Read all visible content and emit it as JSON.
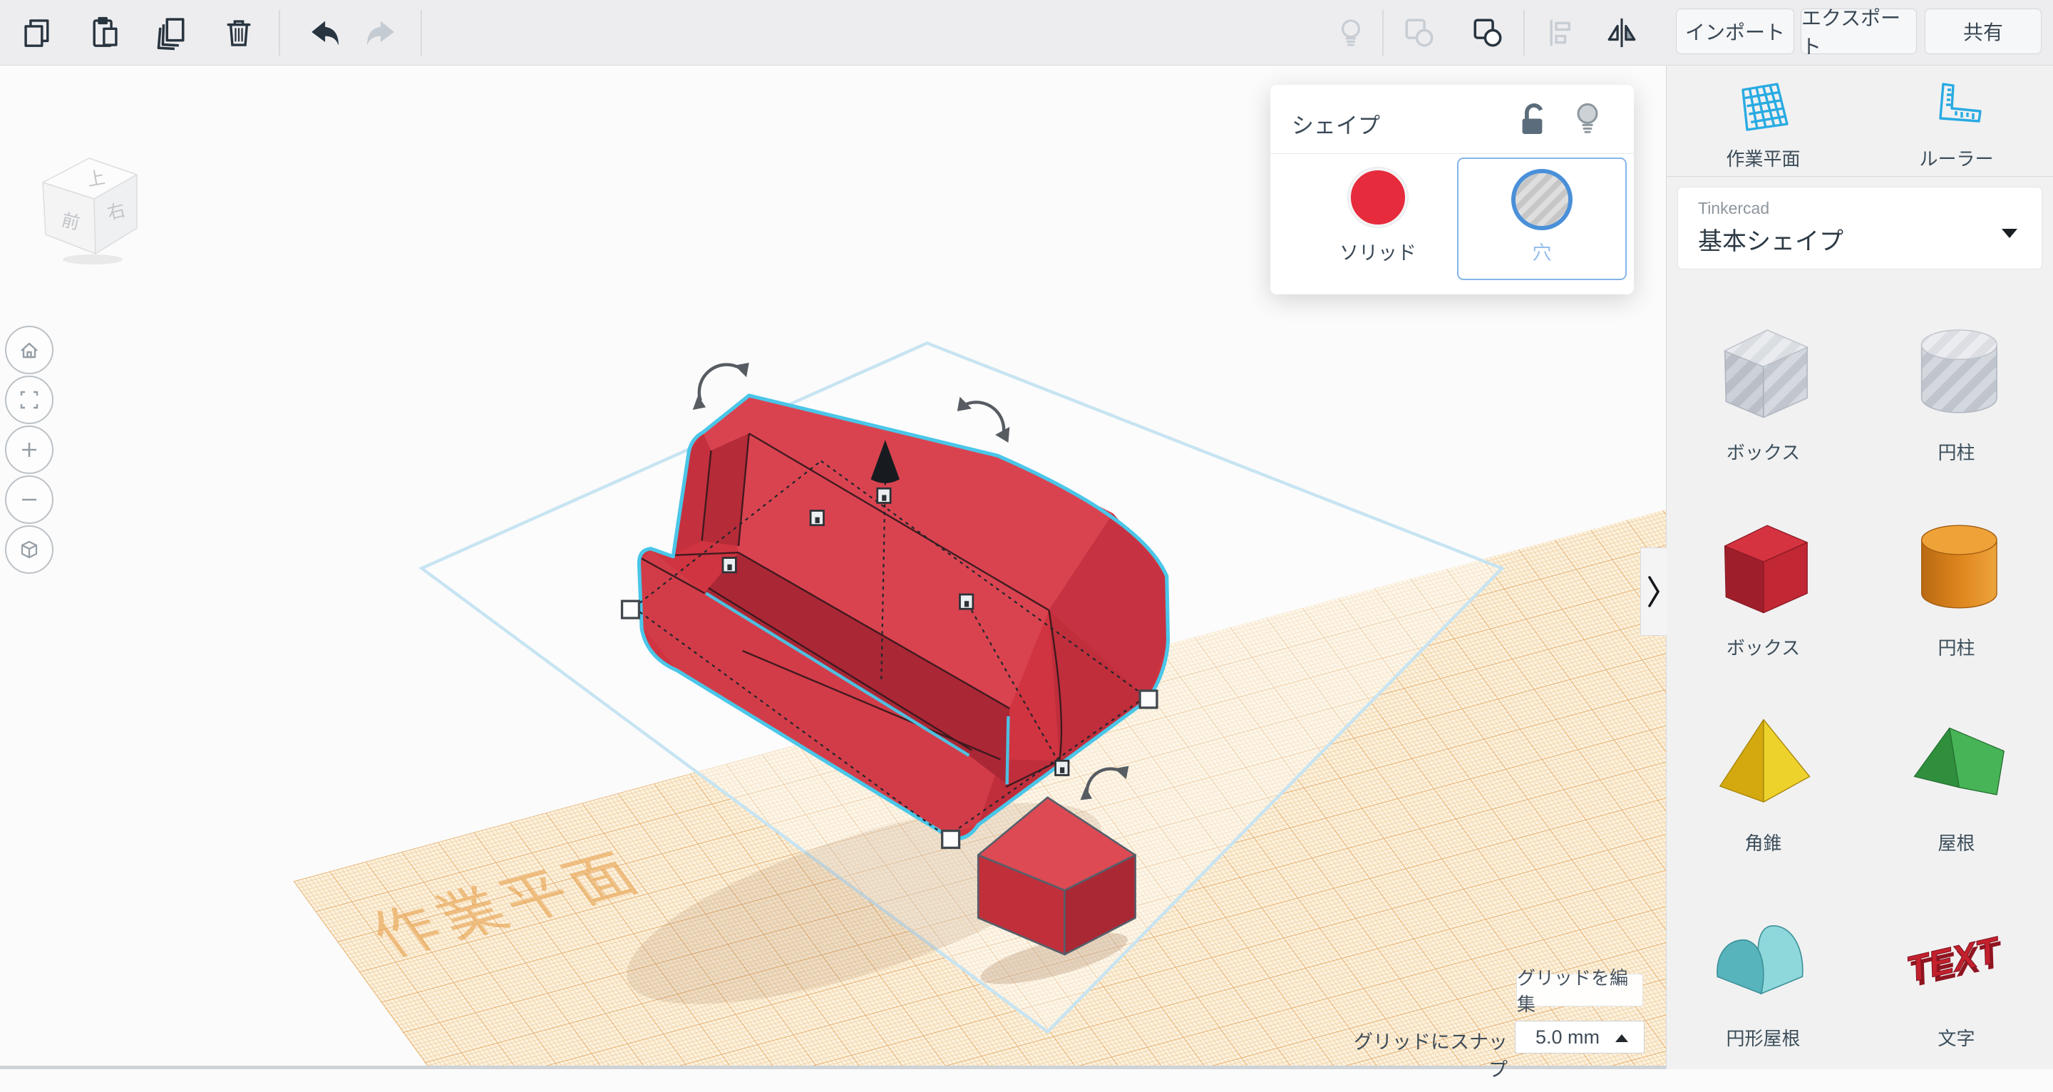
{
  "toolbar": {
    "import_label": "インポート",
    "export_label": "エクスポート",
    "share_label": "共有"
  },
  "shape_popup": {
    "title": "シェイプ",
    "solid_label": "ソリッド",
    "hole_label": "穴"
  },
  "right_panel": {
    "workplane_label": "作業平面",
    "ruler_label": "ルーラー",
    "collection_brand": "Tinkercad",
    "collection_name": "基本シェイプ",
    "shapes": [
      {
        "label": "ボックス"
      },
      {
        "label": "円柱"
      },
      {
        "label": "ボックス"
      },
      {
        "label": "円柱"
      },
      {
        "label": "角錐"
      },
      {
        "label": "屋根"
      },
      {
        "label": "円形屋根"
      },
      {
        "label": "文字",
        "thumb_text": "TEXT"
      }
    ]
  },
  "grid_controls": {
    "edit_label": "グリッドを編集",
    "snap_label": "グリッドにスナップ",
    "snap_value": "5.0 mm"
  },
  "view_cube": {
    "top": "上",
    "front": "前",
    "right": "右"
  },
  "viewport": {
    "watermark": "作業平面"
  },
  "colors": {
    "accent_blue": "#29abe2",
    "selection_cyan": "#4ac6e8",
    "solid_red": "#e62b3c",
    "hole_ring_blue": "#4a90d9",
    "grid_orange": "#e8a04a",
    "model_red": "#d23845"
  }
}
